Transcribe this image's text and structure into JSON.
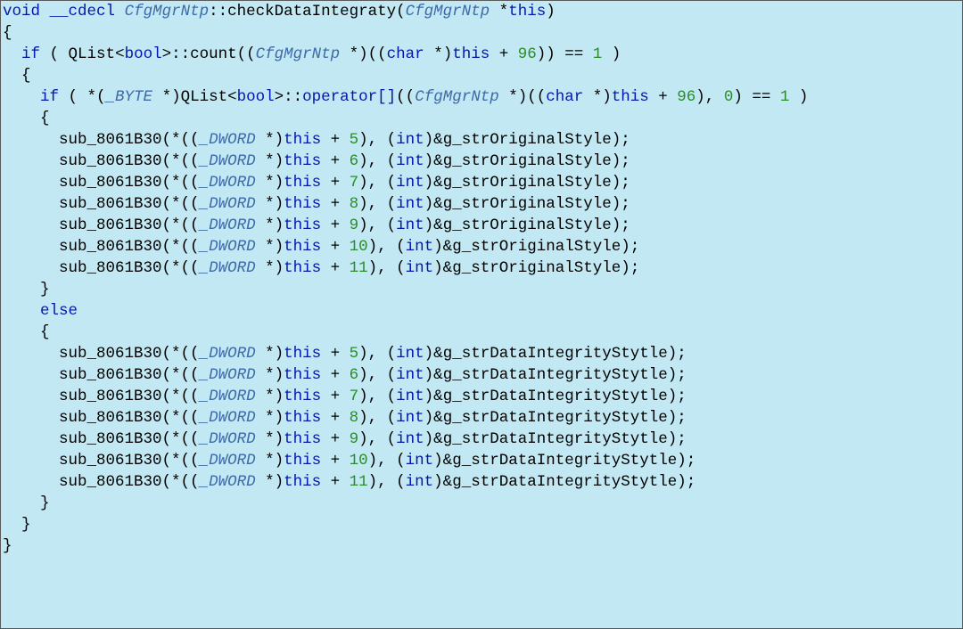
{
  "signature": {
    "ret": "void",
    "cc": "__cdecl",
    "cls": "CfgMgrNtp",
    "method": "checkDataIntegraty",
    "param_type": "CfgMgrNtp",
    "param_ptr": "*",
    "param_name": "this"
  },
  "open_brace": "{",
  "close_brace": "}",
  "outer_if": {
    "kw": "if",
    "lp": " ( ",
    "qlist": "QList",
    "lt": "<",
    "bool": "bool",
    "gt": ">::",
    "count": "count",
    "lp2": "((",
    "cast_type": "CfgMgrNtp",
    "cast_ptr": " *)((",
    "char": "char",
    "char_ptr": " *)",
    "this": "this",
    "plus": " + ",
    "off": "96",
    "rp": "))",
    "eq": " == ",
    "one": "1",
    "rp2": " )"
  },
  "inner_if": {
    "kw": "if",
    "lp": " ( *(",
    "byte": "_BYTE",
    "byte_ptr": " *)",
    "qlist": "QList",
    "lt": "<",
    "bool": "bool",
    "gt": ">::",
    "op": "operator[]",
    "lp2": "((",
    "cast_type": "CfgMgrNtp",
    "cast_ptr": " *)((",
    "char": "char",
    "char_ptr": " *)",
    "this": "this",
    "plus": " + ",
    "off": "96",
    "rp": "), ",
    "zero": "0",
    "rp2": ")",
    "eq": " == ",
    "one": "1",
    "rp3": " )"
  },
  "else_kw": "else",
  "call_common": {
    "fn": "sub_8061B30",
    "lp": "(*((",
    "dword": "_DWORD",
    "dword_ptr": " *)",
    "this": "this",
    "plus": " + ",
    "rp1": "), (",
    "int": "int",
    "rp2": ")&",
    "semi": ");",
    "ref_true": "g_strOriginalStyle",
    "ref_false": "g_strDataIntegrityStytle"
  },
  "offsets_true": [
    "5",
    "6",
    "7",
    "8",
    "9",
    "10",
    "11"
  ],
  "offsets_false": [
    "5",
    "6",
    "7",
    "8",
    "9",
    "10",
    "11"
  ],
  "braces": {
    "open": "{",
    "close": "}"
  }
}
